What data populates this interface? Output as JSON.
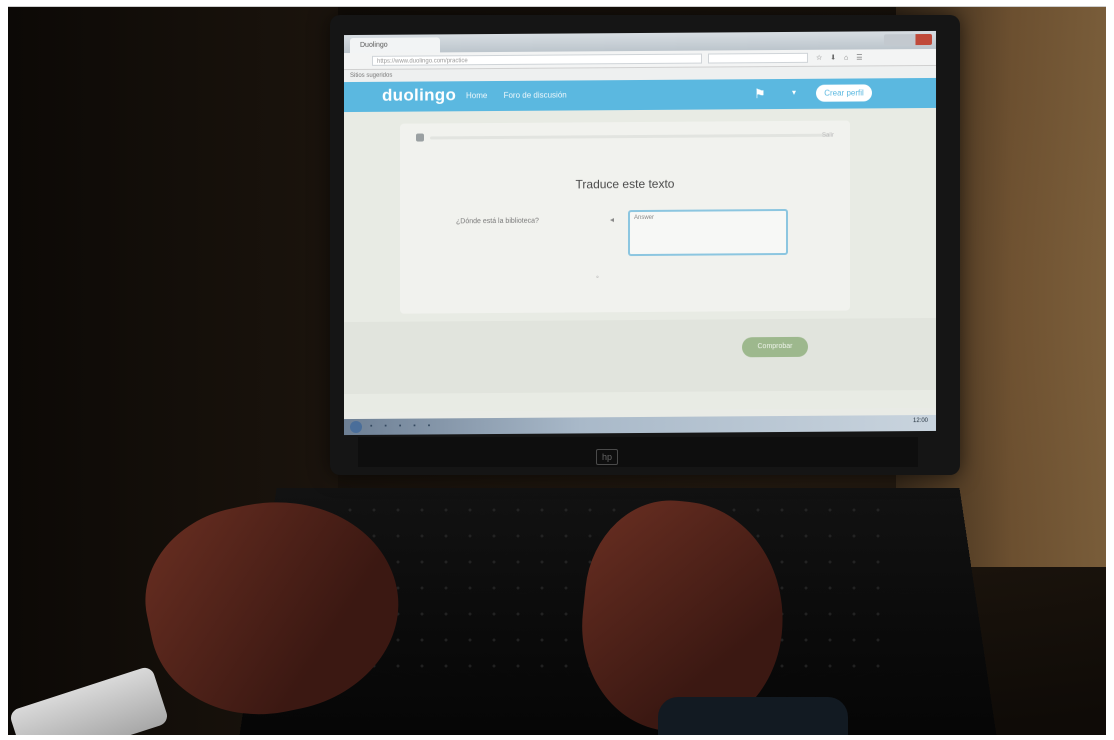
{
  "browser": {
    "tab_title": "Duolingo",
    "url": "https://www.duolingo.com/practice",
    "bookmarks": "Sitios sugeridos",
    "toolbar_icons": "☆ ⬇ ⌂ ☰",
    "window_controls": "– ▢ ✕"
  },
  "duolingo": {
    "logo": "duolingo",
    "nav": [
      "Home",
      "Foro de discusión"
    ],
    "language_flag_icon": "flag-icon",
    "create_account": "Crear perfil",
    "instruction": "Traduce este texto",
    "source_sentence": "¿Dónde está la biblioteca?",
    "answer_placeholder": "Answer",
    "close_label": "Salir",
    "progress": 0.0,
    "check_label": "Comprobar",
    "skip_label": ""
  },
  "taskbar": {
    "clock": "12:00"
  },
  "laptop": {
    "brand": "hp"
  },
  "colors": {
    "duolingo_blue": "#5bb8e0",
    "check_green": "#9db88d",
    "answer_border": "#8cc6e0"
  }
}
